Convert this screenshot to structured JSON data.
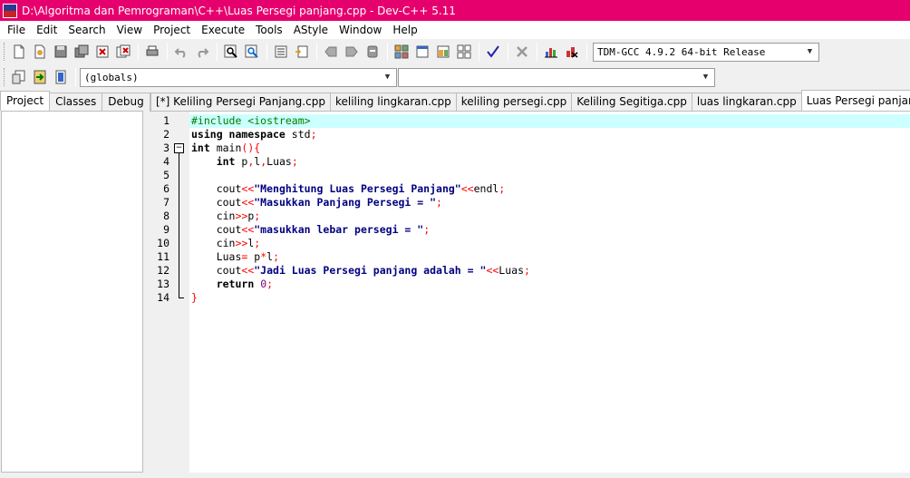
{
  "window": {
    "title": "D:\\Algoritma dan Pemrograman\\C++\\Luas Persegi panjang.cpp - Dev-C++ 5.11"
  },
  "menu": [
    "File",
    "Edit",
    "Search",
    "View",
    "Project",
    "Execute",
    "Tools",
    "AStyle",
    "Window",
    "Help"
  ],
  "compiler_select": {
    "value": "TDM-GCC 4.9.2 64-bit Release"
  },
  "scope_select": {
    "value": "(globals)"
  },
  "symbol_select": {
    "value": ""
  },
  "left_tabs": [
    "Project",
    "Classes",
    "Debug"
  ],
  "editor_tabs": [
    "[*] Keliling Persegi Panjang.cpp",
    "keliling lingkaran.cpp",
    "keliling persegi.cpp",
    "Keliling Segitiga.cpp",
    "luas lingkaran.cpp",
    "Luas Persegi panjang.cpp"
  ],
  "active_tab": "Luas Persegi panjang.cpp",
  "line_numbers": [
    "1",
    "2",
    "3",
    "4",
    "5",
    "6",
    "7",
    "8",
    "9",
    "10",
    "11",
    "12",
    "13",
    "14"
  ],
  "code": [
    [
      {
        "t": "pp",
        "v": "#include <iostream>"
      }
    ],
    [
      {
        "t": "kw",
        "v": "using namespace"
      },
      {
        "t": "n",
        "v": " std"
      },
      {
        "t": "sym",
        "v": ";"
      }
    ],
    [
      {
        "t": "kw",
        "v": "int"
      },
      {
        "t": "n",
        "v": " main"
      },
      {
        "t": "sym",
        "v": "(){"
      }
    ],
    [
      {
        "t": "n",
        "v": "    "
      },
      {
        "t": "kw",
        "v": "int"
      },
      {
        "t": "n",
        "v": " p"
      },
      {
        "t": "sym",
        "v": ","
      },
      {
        "t": "n",
        "v": "l"
      },
      {
        "t": "sym",
        "v": ","
      },
      {
        "t": "n",
        "v": "Luas"
      },
      {
        "t": "sym",
        "v": ";"
      }
    ],
    [],
    [
      {
        "t": "n",
        "v": "    cout"
      },
      {
        "t": "sym",
        "v": "<<"
      },
      {
        "t": "str",
        "v": "\"Menghitung Luas Persegi Panjang\""
      },
      {
        "t": "sym",
        "v": "<<"
      },
      {
        "t": "n",
        "v": "endl"
      },
      {
        "t": "sym",
        "v": ";"
      }
    ],
    [
      {
        "t": "n",
        "v": "    cout"
      },
      {
        "t": "sym",
        "v": "<<"
      },
      {
        "t": "str",
        "v": "\"Masukkan Panjang Persegi = \""
      },
      {
        "t": "sym",
        "v": ";"
      }
    ],
    [
      {
        "t": "n",
        "v": "    cin"
      },
      {
        "t": "sym",
        "v": ">>"
      },
      {
        "t": "n",
        "v": "p"
      },
      {
        "t": "sym",
        "v": ";"
      }
    ],
    [
      {
        "t": "n",
        "v": "    cout"
      },
      {
        "t": "sym",
        "v": "<<"
      },
      {
        "t": "str",
        "v": "\"masukkan lebar persegi = \""
      },
      {
        "t": "sym",
        "v": ";"
      }
    ],
    [
      {
        "t": "n",
        "v": "    cin"
      },
      {
        "t": "sym",
        "v": ">>"
      },
      {
        "t": "n",
        "v": "l"
      },
      {
        "t": "sym",
        "v": ";"
      }
    ],
    [
      {
        "t": "n",
        "v": "    Luas"
      },
      {
        "t": "sym",
        "v": "="
      },
      {
        "t": "n",
        "v": " p"
      },
      {
        "t": "sym",
        "v": "*"
      },
      {
        "t": "n",
        "v": "l"
      },
      {
        "t": "sym",
        "v": ";"
      }
    ],
    [
      {
        "t": "n",
        "v": "    cout"
      },
      {
        "t": "sym",
        "v": "<<"
      },
      {
        "t": "str",
        "v": "\"Jadi Luas Persegi panjang adalah = \""
      },
      {
        "t": "sym",
        "v": "<<"
      },
      {
        "t": "n",
        "v": "Luas"
      },
      {
        "t": "sym",
        "v": ";"
      }
    ],
    [
      {
        "t": "n",
        "v": "    "
      },
      {
        "t": "kw",
        "v": "return"
      },
      {
        "t": "n",
        "v": " "
      },
      {
        "t": "num",
        "v": "0"
      },
      {
        "t": "sym",
        "v": ";"
      }
    ],
    [
      {
        "t": "sym",
        "v": "}"
      }
    ]
  ],
  "colors": {
    "titlebar": "#e6006e",
    "current_line": "#ccffff",
    "keyword": "#000000",
    "string": "#000080",
    "symbol": "#ff0000",
    "preprocessor": "#008000",
    "number": "#800080"
  }
}
